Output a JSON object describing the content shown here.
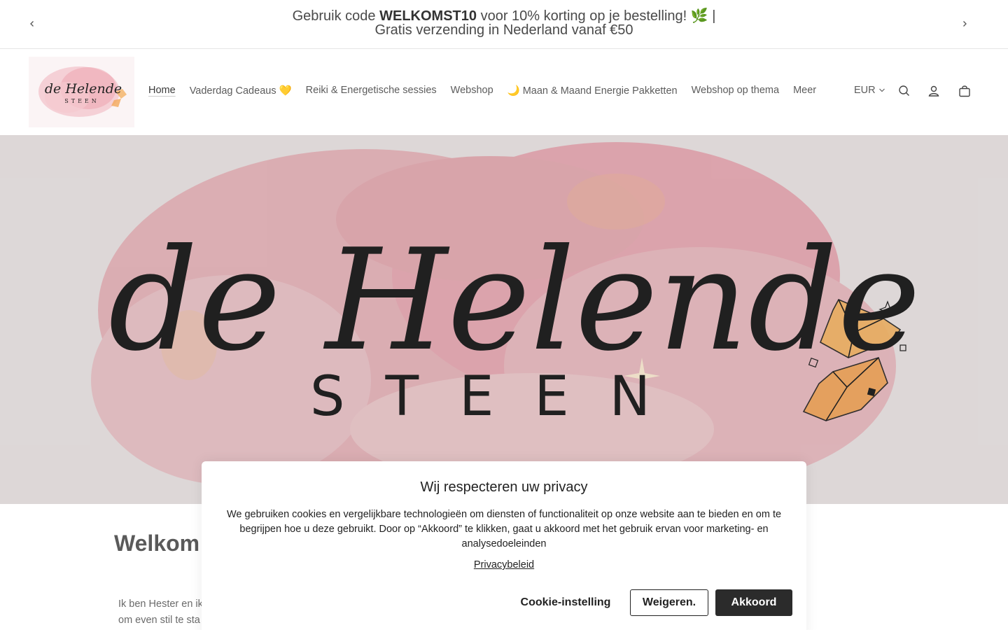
{
  "announcement": {
    "prefix": "Gebruik code ",
    "code": "WELKOMST10",
    "suffix": " voor 10% korting op je bestelling! 🌿 |",
    "line2": "Gratis verzending in Nederland vanaf €50"
  },
  "header": {
    "logo_title": "de Helende",
    "logo_subtitle": "STEEN",
    "nav": [
      {
        "label": "Home"
      },
      {
        "label": "Vaderdag Cadeaus 💛"
      },
      {
        "label": "Reiki & Energetische sessies"
      },
      {
        "label": "Webshop"
      },
      {
        "label": "🌙 Maan & Maand Energie Pakketten"
      },
      {
        "label": "Webshop op thema"
      },
      {
        "label": "Meer"
      }
    ],
    "currency": "EUR"
  },
  "hero": {
    "title": "de Helende",
    "subtitle": "STEEN"
  },
  "content": {
    "welcome": "Welkom",
    "intro_line1": "Ik ben Hester en ik",
    "intro_line2": "om even stil te sta"
  },
  "cookie": {
    "title": "Wij respecteren uw privacy",
    "body": "We gebruiken cookies en vergelijkbare technologieën om diensten of functionaliteit op onze website aan te bieden en om te begrijpen hoe u deze gebruikt. Door op “Akkoord” te klikken, gaat u akkoord met het gebruik ervan voor marketing- en analysedoeleinden",
    "policy_link": "Privacybeleid",
    "settings_button": "Cookie-instelling",
    "decline_button": "Weigeren.",
    "accept_button": "Akkoord"
  },
  "colors": {
    "accept_bg": "#2b2b2b",
    "watercolor_pink": "#e9a9b2",
    "crystal_orange": "#f4a85a"
  }
}
